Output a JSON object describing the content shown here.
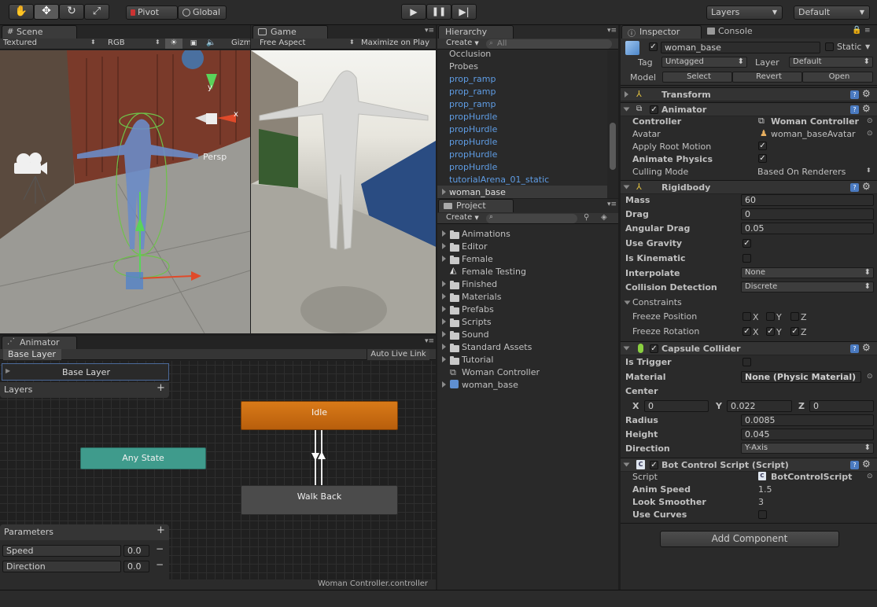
{
  "toolbar": {
    "pivot": "Pivot",
    "global": "Global",
    "layers": "Layers",
    "layout": "Default"
  },
  "scene": {
    "tab": "Scene",
    "shading": "Textured",
    "render": "RGB",
    "gizmos": "Gizmos",
    "persp": "Persp",
    "axis_y": "y",
    "axis_x": "x"
  },
  "game": {
    "tab": "Game",
    "aspect": "Free Aspect",
    "maximize": "Maximize on Play"
  },
  "hierarchy": {
    "tab": "Hierarchy",
    "create": "Create",
    "search": "All",
    "items": [
      "Occlusion",
      "Probes",
      "prop_ramp",
      "prop_ramp",
      "prop_ramp",
      "propHurdle",
      "propHurdle",
      "propHurdle",
      "propHurdle",
      "propHurdle",
      "tutorialArena_01_static",
      "woman_base"
    ]
  },
  "project": {
    "tab": "Project",
    "create": "Create",
    "items": [
      "Animations",
      "Editor",
      "Female",
      "Female Testing",
      "Finished",
      "Materials",
      "Prefabs",
      "Scripts",
      "Sound",
      "Standard Assets",
      "Tutorial",
      "Woman Controller",
      "woman_base"
    ]
  },
  "animator": {
    "tab": "Animator",
    "breadcrumb": "Base Layer",
    "autolive": "Auto Live Link",
    "layer_name": "Base Layer",
    "layers_label": "Layers",
    "parameters_label": "Parameters",
    "params": [
      {
        "name": "Speed",
        "value": "0.0"
      },
      {
        "name": "Direction",
        "value": "0.0"
      }
    ],
    "states": {
      "idle": "Idle",
      "any": "Any State",
      "walk": "Walk Back"
    },
    "footer": "Woman Controller.controller"
  },
  "inspector": {
    "tab": "Inspector",
    "console_tab": "Console",
    "name": "woman_base",
    "static": "Static",
    "tag_label": "Tag",
    "tag": "Untagged",
    "layer_label": "Layer",
    "layer": "Default",
    "model_label": "Model",
    "select": "Select",
    "revert": "Revert",
    "open": "Open",
    "transform": "Transform",
    "animator": {
      "title": "Animator",
      "controller_label": "Controller",
      "controller": "Woman Controller",
      "avatar_label": "Avatar",
      "avatar": "woman_baseAvatar",
      "root_motion": "Apply Root Motion",
      "animate_physics": "Animate Physics",
      "culling_label": "Culling Mode",
      "culling": "Based On Renderers"
    },
    "rigidbody": {
      "title": "Rigidbody",
      "mass_label": "Mass",
      "mass": "60",
      "drag_label": "Drag",
      "drag": "0",
      "adrag_label": "Angular Drag",
      "adrag": "0.05",
      "gravity": "Use Gravity",
      "kinematic": "Is Kinematic",
      "interp_label": "Interpolate",
      "interp": "None",
      "collision_label": "Collision Detection",
      "collision": "Discrete",
      "constraints": "Constraints",
      "freeze_pos": "Freeze Position",
      "freeze_rot": "Freeze Rotation",
      "x": "X",
      "y": "Y",
      "z": "Z"
    },
    "capsule": {
      "title": "Capsule Collider",
      "trigger": "Is Trigger",
      "material_label": "Material",
      "material": "None (Physic Material)",
      "center_label": "Center",
      "cx_label": "X",
      "cx": "0",
      "cy_label": "Y",
      "cy": "0.022",
      "cz_label": "Z",
      "cz": "0",
      "radius_label": "Radius",
      "radius": "0.0085",
      "height_label": "Height",
      "height": "0.045",
      "direction_label": "Direction",
      "direction": "Y-Axis"
    },
    "script": {
      "title": "Bot Control Script (Script)",
      "script_label": "Script",
      "script": "BotControlScript",
      "anim_speed_label": "Anim Speed",
      "anim_speed": "1.5",
      "look_label": "Look Smoother",
      "look": "3",
      "curves_label": "Use Curves"
    },
    "add_component": "Add Component"
  }
}
